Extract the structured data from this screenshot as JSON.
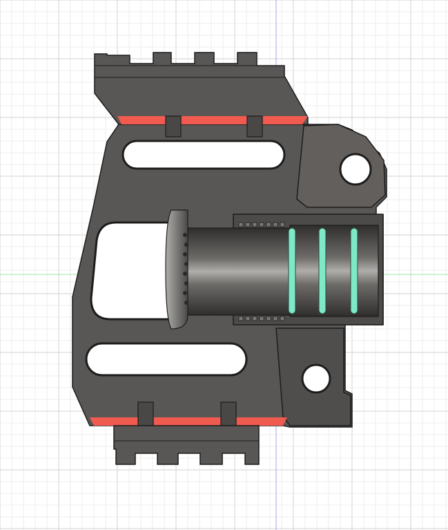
{
  "viewport": {
    "background": "#ffffff",
    "grid_minor_color": "#eeeeee",
    "grid_major_color": "#d2d2d2",
    "axis_x_color": "#9fe39f",
    "axis_y_color": "#a6a6e8"
  },
  "model": {
    "body_color": "#595755",
    "body_shadow_color": "#3e3c3a",
    "body_highlight_color": "#8a8885",
    "edge_color": "#1c1c1c",
    "cut_color": "#ffffff",
    "accent_red": "#f05a4f",
    "accent_teal": "#7fe8c7",
    "bore_dark": "#2f2e2d",
    "bore_light": "#b0aeab"
  }
}
